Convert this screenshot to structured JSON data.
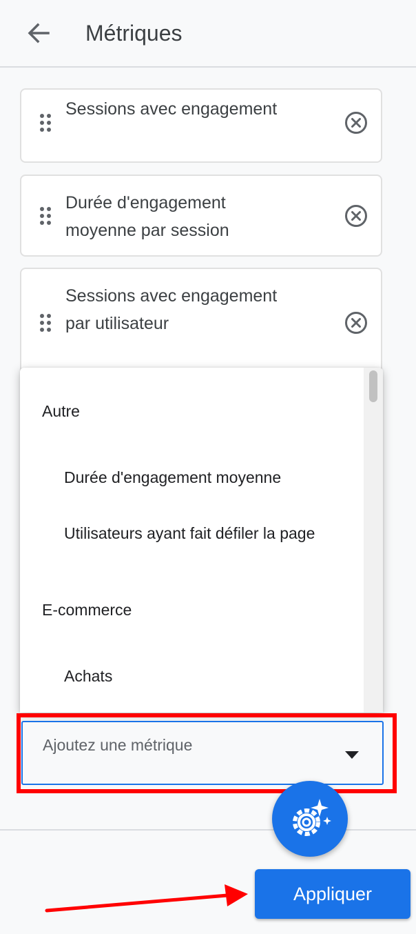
{
  "header": {
    "title": "Métriques",
    "back_icon": "arrow-back-icon"
  },
  "selected_metrics": [
    {
      "label": "Sessions avec engagement"
    },
    {
      "label": "Durée d'engagement moyenne par session"
    },
    {
      "label": "Sessions avec engagement par utilisateur"
    }
  ],
  "dropdown": {
    "groups": [
      {
        "label": "Autre",
        "options": [
          "Durée d'engagement moyenne",
          "Utilisateurs ayant fait défiler la page"
        ]
      },
      {
        "label": "E-commerce",
        "options": [
          "Achats"
        ]
      }
    ]
  },
  "metric_input": {
    "placeholder": "Ajoutez une métrique"
  },
  "fab": {
    "icon": "settings-sparkle-icon"
  },
  "apply_button": {
    "label": "Appliquer"
  },
  "colors": {
    "accent": "#1a73e8",
    "annotation": "#ff0000"
  }
}
